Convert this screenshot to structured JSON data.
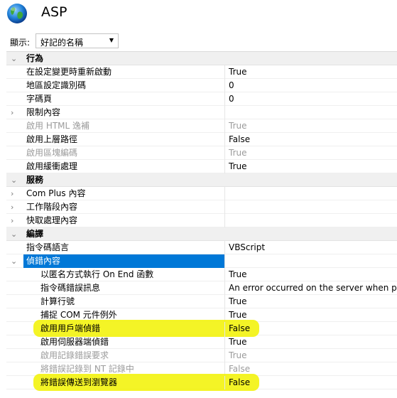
{
  "header": {
    "title": "ASP"
  },
  "display": {
    "label": "顯示:",
    "value": "好記的名稱"
  },
  "rows": [
    {
      "type": "category",
      "name": "行為",
      "expanded": true
    },
    {
      "type": "prop",
      "name": "在設定變更時重新啟動",
      "value": "True"
    },
    {
      "type": "prop",
      "name": "地區設定識別碼",
      "value": "0"
    },
    {
      "type": "prop",
      "name": "字碼頁",
      "value": "0"
    },
    {
      "type": "group",
      "name": "限制內容",
      "expanded": false
    },
    {
      "type": "prop",
      "name": "啟用 HTML 逸補",
      "value": "True",
      "disabled": true
    },
    {
      "type": "prop",
      "name": "啟用上層路徑",
      "value": "False"
    },
    {
      "type": "prop",
      "name": "啟用區塊編碼",
      "value": "True",
      "disabled": true
    },
    {
      "type": "prop",
      "name": "啟用緩衝處理",
      "value": "True"
    },
    {
      "type": "category",
      "name": "服務",
      "expanded": true
    },
    {
      "type": "group",
      "name": "Com Plus 內容",
      "expanded": false
    },
    {
      "type": "group",
      "name": "工作階段內容",
      "expanded": false
    },
    {
      "type": "group",
      "name": "快取處理內容",
      "expanded": false
    },
    {
      "type": "category",
      "name": "編譯",
      "expanded": true
    },
    {
      "type": "prop",
      "name": "指令碼語言",
      "value": "VBScript"
    },
    {
      "type": "group",
      "name": "偵錯內容",
      "expanded": true,
      "selected": true
    },
    {
      "type": "prop",
      "name": "以匿名方式執行 On End 函數",
      "value": "True",
      "indent": true
    },
    {
      "type": "prop",
      "name": "指令碼錯誤訊息",
      "value": "An error occurred on the server when pr",
      "indent": true
    },
    {
      "type": "prop",
      "name": "計算行號",
      "value": "True",
      "indent": true
    },
    {
      "type": "prop",
      "name": "捕捉 COM 元件例外",
      "value": "True",
      "indent": true
    },
    {
      "type": "prop",
      "name": "啟用用戶端偵錯",
      "value": "False",
      "indent": true,
      "highlighted": true
    },
    {
      "type": "prop",
      "name": "啟用伺服器端偵錯",
      "value": "True",
      "indent": true
    },
    {
      "type": "prop",
      "name": "啟用記錄錯誤要求",
      "value": "True",
      "indent": true,
      "disabled": true
    },
    {
      "type": "prop",
      "name": "將錯誤記錄到 NT 記錄中",
      "value": "False",
      "indent": true,
      "disabled": true
    },
    {
      "type": "prop",
      "name": "將錯誤傳送到瀏覽器",
      "value": "False",
      "indent": true,
      "highlighted": true
    }
  ]
}
